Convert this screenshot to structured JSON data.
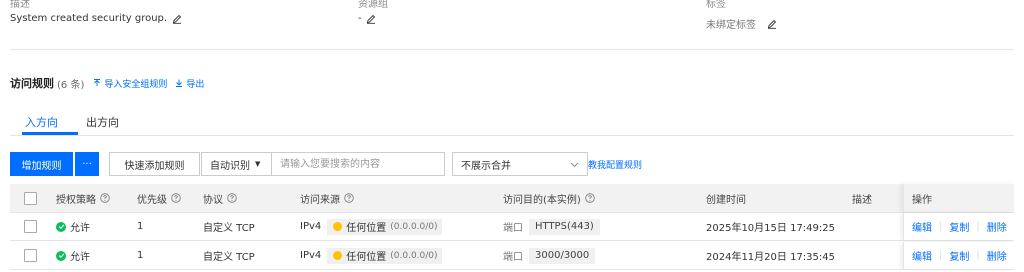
{
  "info": {
    "description": {
      "label": "描述",
      "value": "System created security group."
    },
    "resource_group": {
      "label": "资源组",
      "value": "-"
    },
    "tags": {
      "label": "标签",
      "value": "未绑定标签"
    }
  },
  "rules": {
    "title": "访问规则",
    "count": "(6 条)",
    "import_label": "导入安全组规则",
    "export_label": "导出"
  },
  "tabs": [
    {
      "label": "入方向",
      "active": true
    },
    {
      "label": "出方向",
      "active": false
    }
  ],
  "toolbar": {
    "add_rule": "增加规则",
    "more": "···",
    "quick_add": "快速添加规则",
    "search_mode": "自动识别",
    "search_placeholder": "请输入您要搜索的内容",
    "merge_option": "不展示合并",
    "help_link": "教我配置规则"
  },
  "table": {
    "headers": {
      "policy": "授权策略",
      "priority": "优先级",
      "protocol": "协议",
      "source": "访问来源",
      "destination": "访问目的(本实例)",
      "created": "创建时间",
      "description": "描述",
      "actions": "操作"
    },
    "rows": [
      {
        "policy": "允许",
        "priority": "1",
        "protocol": "自定义 TCP",
        "ip_version": "IPv4",
        "source_name": "任何位置",
        "source_cidr": "(0.0.0.0/0)",
        "port_label": "端口",
        "port": "HTTPS(443)",
        "created": "2025年10月15日 17:49:25",
        "actions": {
          "edit": "编辑",
          "copy": "复制",
          "delete": "删除"
        }
      },
      {
        "policy": "允许",
        "priority": "1",
        "protocol": "自定义 TCP",
        "ip_version": "IPv4",
        "source_name": "任何位置",
        "source_cidr": "(0.0.0.0/0)",
        "port_label": "端口",
        "port": "3000/3000",
        "created": "2024年11月20日 17:35:45",
        "actions": {
          "edit": "编辑",
          "copy": "复制",
          "delete": "删除"
        }
      }
    ]
  },
  "colors": {
    "accent": "#006eff",
    "allow": "#0abf5b",
    "source_dot": "#ffc300"
  }
}
